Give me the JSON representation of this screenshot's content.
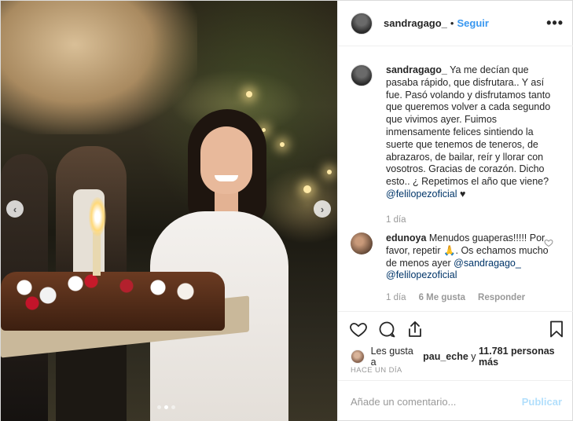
{
  "post": {
    "username": "sandragago_",
    "separator": "•",
    "follow_label": "Seguir",
    "more_label": "•••"
  },
  "caption": {
    "username": "sandragago_",
    "text": "Ya me decían que pasaba rápido, que disfrutara.. Y así fue. Pasó volando y disfrutamos tanto que queremos volver a cada segundo que vivimos ayer. Fuimos inmensamente felices sintiendo la suerte que tenemos de teneros, de abrazaros, de bailar, reír y llorar con vosotros. Gracias de corazón. Dicho esto.. ¿ Repetimos el año que viene?",
    "mention": "@felilopezoficial",
    "heart": "♥",
    "time": "1 día"
  },
  "reply": {
    "username": "edunoya",
    "text": "Menudos guaperas!!!!! Por favor, repetir 🙏. Os echamos mucho de menos ayer",
    "mention1": "@sandragago_",
    "mention2": "@felilopezoficial",
    "time": "1 día",
    "likes": "6 Me gusta",
    "reply_label": "Responder"
  },
  "likes_line": {
    "prefix": "Les gusta a",
    "user": "pau_eche",
    "connector": "y",
    "count": "11.781 personas más"
  },
  "timestamp": "HACE UN DÍA",
  "add_comment": {
    "placeholder": "Añade un comentario...",
    "publish_label": "Publicar"
  },
  "carousel": {
    "prev_icon": "‹",
    "next_icon": "›",
    "slide_count": 3,
    "active_slide": 2
  },
  "colors": {
    "accent": "#3897f0",
    "publish_disabled": "#b2dffc",
    "mention": "#003569",
    "muted": "#999999"
  },
  "icons": {
    "like": "heart-icon",
    "comment": "comment-icon",
    "share": "share-icon",
    "save": "bookmark-icon"
  }
}
